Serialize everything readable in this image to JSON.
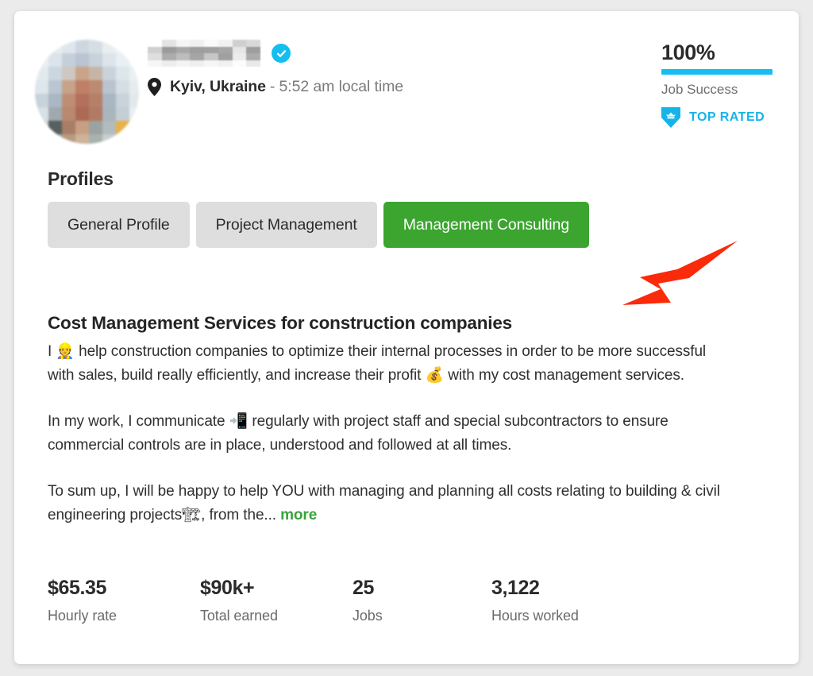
{
  "profile": {
    "name_redacted": true,
    "verified_icon": "verified-check-icon",
    "location_icon": "map-pin-icon",
    "location": "Kyiv, Ukraine",
    "local_time": "- 5:52 am local time"
  },
  "job_success": {
    "percent": "100%",
    "label": "Job Success",
    "bar_color": "#14bef0",
    "badge_icon": "shield-crown-icon",
    "badge_label": "TOP RATED",
    "badge_color": "#14b4e8"
  },
  "profiles": {
    "heading": "Profiles",
    "tabs": [
      {
        "label": "General Profile",
        "active": false
      },
      {
        "label": "Project Management",
        "active": false
      },
      {
        "label": "Management Consulting",
        "active": true
      }
    ],
    "active_color": "#3ba52f",
    "inactive_color": "#dedede"
  },
  "content": {
    "headline": "Cost Management Services for construction companies",
    "paragraph_1_a": "I ",
    "paragraph_1_emoji": "👷",
    "paragraph_1_b": " help construction companies to optimize their internal processes in order to be more successful with sales, build really efficiently, and increase their profit ",
    "paragraph_1_emoji_2": "💰",
    "paragraph_1_c": " with my cost management services.",
    "paragraph_2_a": "In my work, I communicate ",
    "paragraph_2_emoji": "📲",
    "paragraph_2_b": " regularly with project staff and special subcontractors to ensure commercial controls are in place, understood and followed at all times.",
    "paragraph_3_a": "To sum up, I will be happy to help YOU with managing and planning all costs relating to building & civil engineering projects",
    "paragraph_3_emoji": "🏗",
    "paragraph_3_b": ", from the... ",
    "more_label": "more",
    "more_color": "#3aa33a"
  },
  "stats": [
    {
      "value": "$65.35",
      "label": "Hourly rate"
    },
    {
      "value": "$90k+",
      "label": "Total earned"
    },
    {
      "value": "25",
      "label": "Jobs"
    },
    {
      "value": "3,122",
      "label": "Hours worked"
    }
  ],
  "annotation": {
    "arrow_color": "#fa2a0a",
    "points_to": "Management Consulting"
  }
}
